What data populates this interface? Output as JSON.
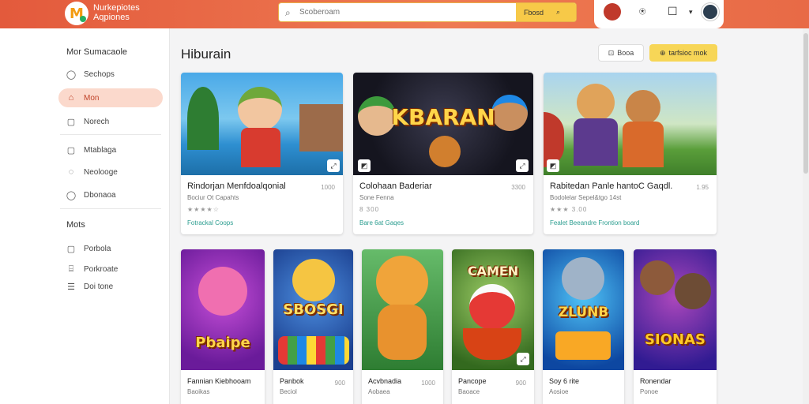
{
  "header": {
    "brand_line1": "Nurkepiotes",
    "brand_line2": "Aqpiones",
    "search_placeholder": "Scoberoam",
    "search_button": "Fbosd",
    "icons": [
      "user-icon",
      "notification-icon",
      "chat-icon",
      "chevron-down-icon",
      "avatar"
    ]
  },
  "sidebar": {
    "section1": "Mor Sumacaole",
    "items1": [
      {
        "label": "Sechops",
        "icon": "circle-icon"
      },
      {
        "label": "Mon",
        "icon": "home-icon"
      },
      {
        "label": "Norech",
        "icon": "square-icon"
      },
      {
        "label": "Mtablaga",
        "icon": "square-icon"
      },
      {
        "label": "Neolooge",
        "icon": "chat-bubble-icon"
      },
      {
        "label": "Dbonaoa",
        "icon": "circle-icon"
      }
    ],
    "section2": "Mots",
    "items2": [
      {
        "label": "Porbola",
        "icon": "square-icon"
      },
      {
        "label": "Porkroate",
        "icon": "controller-icon"
      },
      {
        "label": "Doi tone",
        "icon": "list-icon"
      }
    ]
  },
  "main": {
    "title": "Hiburain",
    "button_outline": "Booa",
    "button_primary": "tarfsioc mok",
    "featured": [
      {
        "title": "Rindorjan Menfdoalqonial",
        "price": "1000",
        "subtitle": "Bociur Ot Capahts",
        "rating": "★★★★☆",
        "link": "Fotrackal Coops",
        "art": ""
      },
      {
        "title": "Colohaan Baderiar",
        "price": "3300",
        "subtitle": "Sone Fenna",
        "rating": "8 300",
        "link": "Bare 6at Gaqes",
        "art": "KBARAN"
      },
      {
        "title": "Rabitedan Panle hantoC Gaqdl.",
        "price": "1.95",
        "subtitle": "Bodolelar Sepel&tgo 14st",
        "rating": "★★★ 3.00",
        "link": "Fealet Beeandre Frontion board",
        "art": ""
      }
    ],
    "games": [
      {
        "title": "Fannian Kiebhooam",
        "sub": "Baoikas",
        "price": "",
        "art": "Pbaipe"
      },
      {
        "title": "Panbok",
        "sub": "Beciol",
        "price": "900",
        "art": "SBOSGI"
      },
      {
        "title": "Acvbnadia",
        "sub": "Aobaea",
        "price": "1000",
        "art": ""
      },
      {
        "title": "Pancope",
        "sub": "Baoace",
        "price": "900",
        "art": "CAMEN"
      },
      {
        "title": "Soy 6 rite",
        "sub": "Aosioe",
        "price": "",
        "art": "ZLUNB"
      },
      {
        "title": "Ronendar",
        "sub": "Ponoe",
        "price": "",
        "art": "SIONAS"
      }
    ]
  },
  "colors": {
    "header_red": "#e35a3c",
    "accent_yellow": "#f7c948",
    "active_bg": "#fbd9cc",
    "link_teal": "#2a9d8f"
  }
}
